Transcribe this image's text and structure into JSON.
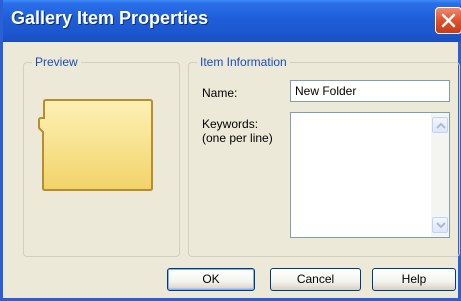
{
  "window": {
    "title": "Gallery Item Properties"
  },
  "preview": {
    "group_label": "Preview",
    "icon": "folder-icon"
  },
  "item_info": {
    "group_label": "Item Information",
    "name_label": "Name:",
    "name_value": "New Folder",
    "keywords_label_line1": "Keywords:",
    "keywords_label_line2": "(one per line)",
    "keywords_value": ""
  },
  "buttons": {
    "ok": "OK",
    "cancel": "Cancel",
    "help": "Help"
  },
  "colors": {
    "titlebar": "#1e5ed8",
    "close": "#e0512c",
    "group_label": "#1a4cb9",
    "folder": "#f7dc7a"
  }
}
